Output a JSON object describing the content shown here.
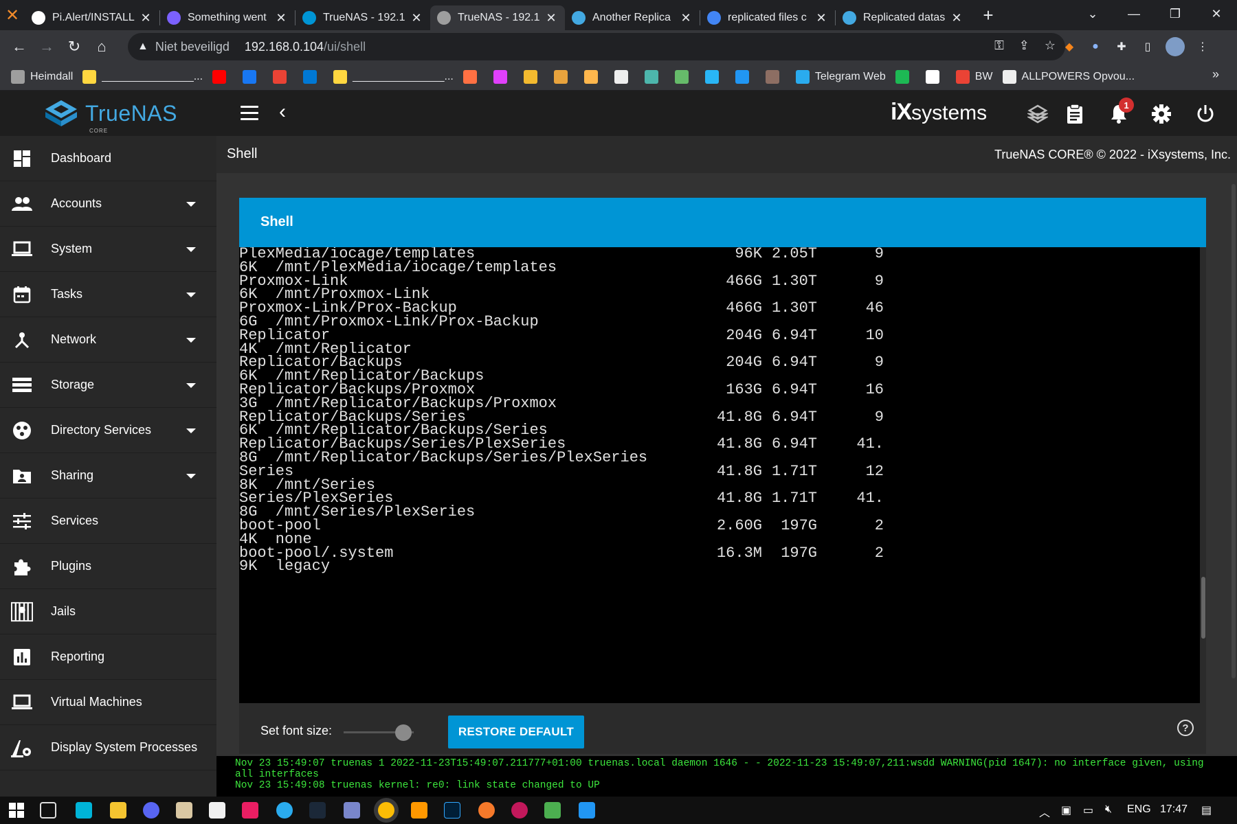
{
  "browser": {
    "tabs": [
      {
        "label": "Pi.Alert/INSTALL",
        "active": false,
        "favicon_color": "#ffffff"
      },
      {
        "label": "Something went",
        "active": false,
        "favicon_color": "#7b61ff"
      },
      {
        "label": "TrueNAS - 192.1",
        "active": false,
        "favicon_color": "#0095d5"
      },
      {
        "label": "TrueNAS - 192.1",
        "active": true,
        "favicon_color": "#9e9e9e"
      },
      {
        "label": "Another Replica",
        "active": false,
        "favicon_color": "#43a9e2"
      },
      {
        "label": "replicated files c",
        "active": false,
        "favicon_color": "#4285f4"
      },
      {
        "label": "Replicated datas",
        "active": false,
        "favicon_color": "#43a9e2"
      }
    ],
    "address": {
      "security_label": "Niet beveiligd",
      "url_host": "192.168.0.104",
      "url_path": "/ui/shell"
    },
    "bookmarks": [
      {
        "label": "Heimdall",
        "color": "#9e9e9e"
      },
      {
        "label": "_______________...",
        "color": "#ffd740"
      },
      {
        "label": "",
        "color": "#ff0000"
      },
      {
        "label": "",
        "color": "#1877f2"
      },
      {
        "label": "",
        "color": "#ea4335"
      },
      {
        "label": "",
        "color": "#0078d4"
      },
      {
        "label": "_______________...",
        "color": "#ffd740"
      },
      {
        "label": "",
        "color": "#ff7043"
      },
      {
        "label": "",
        "color": "#e040fb"
      },
      {
        "label": "",
        "color": "#f3ba2f"
      },
      {
        "label": "",
        "color": "#e8a33d"
      },
      {
        "label": "",
        "color": "#ffb74d"
      },
      {
        "label": "",
        "color": "#eeeeee"
      },
      {
        "label": "",
        "color": "#4db6ac"
      },
      {
        "label": "",
        "color": "#66bb6a"
      },
      {
        "label": "",
        "color": "#29b6f6"
      },
      {
        "label": "",
        "color": "#2196f3"
      },
      {
        "label": "",
        "color": "#8d6e63"
      },
      {
        "label": "Telegram Web",
        "color": "#2aabee"
      },
      {
        "label": "",
        "color": "#1db954"
      },
      {
        "label": "",
        "color": "#ffffff"
      },
      {
        "label": "BW",
        "color": "#ea4335"
      },
      {
        "label": "ALLPOWERS Opvou...",
        "color": "#eeeeee"
      }
    ]
  },
  "header": {
    "logo_text": "TrueNAS",
    "logo_sub": "CORE",
    "brand_ix": "iX",
    "brand_systems": "systems",
    "notification_count": "1"
  },
  "sidebar": {
    "items": [
      {
        "label": "Dashboard",
        "icon": "dashboard-icon",
        "has_caret": false
      },
      {
        "label": "Accounts",
        "icon": "accounts-icon",
        "has_caret": true
      },
      {
        "label": "System",
        "icon": "laptop-icon",
        "has_caret": true
      },
      {
        "label": "Tasks",
        "icon": "calendar-icon",
        "has_caret": true
      },
      {
        "label": "Network",
        "icon": "network-icon",
        "has_caret": true
      },
      {
        "label": "Storage",
        "icon": "storage-icon",
        "has_caret": true
      },
      {
        "label": "Directory Services",
        "icon": "directory-icon",
        "has_caret": true
      },
      {
        "label": "Sharing",
        "icon": "folder-share-icon",
        "has_caret": true
      },
      {
        "label": "Services",
        "icon": "sliders-icon",
        "has_caret": false
      },
      {
        "label": "Plugins",
        "icon": "puzzle-icon",
        "has_caret": false
      },
      {
        "label": "Jails",
        "icon": "jail-icon",
        "has_caret": false
      },
      {
        "label": "Reporting",
        "icon": "chart-icon",
        "has_caret": false
      },
      {
        "label": "Virtual Machines",
        "icon": "laptop-icon",
        "has_caret": false
      },
      {
        "label": "Display System Processes",
        "icon": "processes-icon",
        "has_caret": false
      }
    ]
  },
  "page": {
    "title": "Shell",
    "copyright": "TrueNAS CORE® © 2022 - iXsystems, Inc."
  },
  "shell": {
    "card_title": "Shell",
    "lines": [
      {
        "name": "PlexMedia/iocage/templates",
        "used": "96K",
        "avail": "2.05T",
        "refer": "9"
      },
      {
        "name": "6K  /mnt/PlexMedia/iocage/templates"
      },
      {
        "name": "Proxmox-Link",
        "used": "466G",
        "avail": "1.30T",
        "refer": "9"
      },
      {
        "name": "6K  /mnt/Proxmox-Link"
      },
      {
        "name": "Proxmox-Link/Prox-Backup",
        "used": "466G",
        "avail": "1.30T",
        "refer": "46"
      },
      {
        "name": "6G  /mnt/Proxmox-Link/Prox-Backup"
      },
      {
        "name": "Replicator",
        "used": "204G",
        "avail": "6.94T",
        "refer": "10"
      },
      {
        "name": "4K  /mnt/Replicator"
      },
      {
        "name": "Replicator/Backups",
        "used": "204G",
        "avail": "6.94T",
        "refer": "9"
      },
      {
        "name": "6K  /mnt/Replicator/Backups"
      },
      {
        "name": "Replicator/Backups/Proxmox",
        "used": "163G",
        "avail": "6.94T",
        "refer": "16"
      },
      {
        "name": "3G  /mnt/Replicator/Backups/Proxmox"
      },
      {
        "name": "Replicator/Backups/Series",
        "used": "41.8G",
        "avail": "6.94T",
        "refer": "9"
      },
      {
        "name": "6K  /mnt/Replicator/Backups/Series"
      },
      {
        "name": "Replicator/Backups/Series/PlexSeries",
        "used": "41.8G",
        "avail": "6.94T",
        "refer": "41."
      },
      {
        "name": "8G  /mnt/Replicator/Backups/Series/PlexSeries"
      },
      {
        "name": "Series",
        "used": "41.8G",
        "avail": "1.71T",
        "refer": "12"
      },
      {
        "name": "8K  /mnt/Series"
      },
      {
        "name": "Series/PlexSeries",
        "used": "41.8G",
        "avail": "1.71T",
        "refer": "41."
      },
      {
        "name": "8G  /mnt/Series/PlexSeries"
      },
      {
        "name": "boot-pool",
        "used": "2.60G",
        "avail": "197G",
        "refer": "2"
      },
      {
        "name": "4K  none"
      },
      {
        "name": "boot-pool/.system",
        "used": "16.3M",
        "avail": "197G",
        "refer": "2"
      },
      {
        "name": "9K  legacy"
      }
    ],
    "font_size_label": "Set font size:",
    "font_size_level": 0.85,
    "restore_label": "RESTORE DEFAULT"
  },
  "console": {
    "lines": [
      "Nov 23 15:49:07 truenas 1 2022-11-23T15:49:07.211777+01:00 truenas.local daemon 1646 - - 2022-11-23 15:49:07,211:wsdd WARNING(pid 1647): no interface given, using",
      "all interfaces",
      "Nov 23 15:49:08 truenas kernel: re0: link state changed to UP"
    ]
  },
  "taskbar": {
    "language": "ENG",
    "time": "17:47"
  },
  "colors": {
    "accent": "#0095d5",
    "sidebar_bg": "#282828",
    "console_text": "#3de63d",
    "badge": "#d32f2f"
  }
}
